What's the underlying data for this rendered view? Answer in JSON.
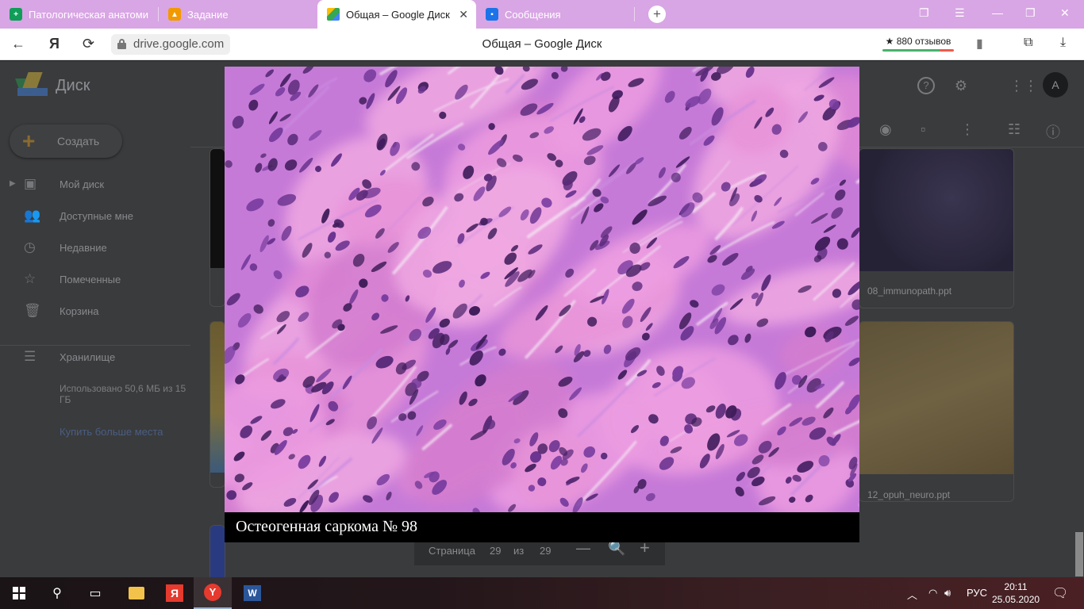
{
  "browser": {
    "tabs": [
      {
        "label": "Патологическая анатоми",
        "icon": "sheets-icon",
        "color": "#0f9d58"
      },
      {
        "label": "Задание",
        "icon": "classroom-icon",
        "color": "#f29900"
      },
      {
        "label": "Общая – Google Диск",
        "icon": "drive-icon",
        "color": "#4285f4"
      },
      {
        "label": "Сообщения",
        "icon": "chat-icon",
        "color": "#1a73e8"
      }
    ],
    "url": "drive.google.com",
    "page_title": "Общая – Google Диск",
    "reviews": "★ 880 отзывов"
  },
  "drive": {
    "app_title": "Диск",
    "create_label": "Создать",
    "nav": [
      "Мой диск",
      "Доступные мне",
      "Недавние",
      "Помеченные",
      "Корзина"
    ],
    "storage_label": "Хранилище",
    "storage_text": "Использовано 50,6 МБ из 15 ГБ",
    "buy_more": "Купить больше места",
    "avatar_letter": "A",
    "files": [
      "08_immunopath.ppt",
      "12_opuh_neuro.ppt"
    ],
    "pager": {
      "label": "Страница",
      "current": "29",
      "of": "из",
      "total": "29"
    }
  },
  "viewer": {
    "caption": "Остеогенная саркома №  98"
  },
  "taskbar": {
    "lang": "РУС",
    "time": "20:11",
    "date": "25.05.2020"
  }
}
